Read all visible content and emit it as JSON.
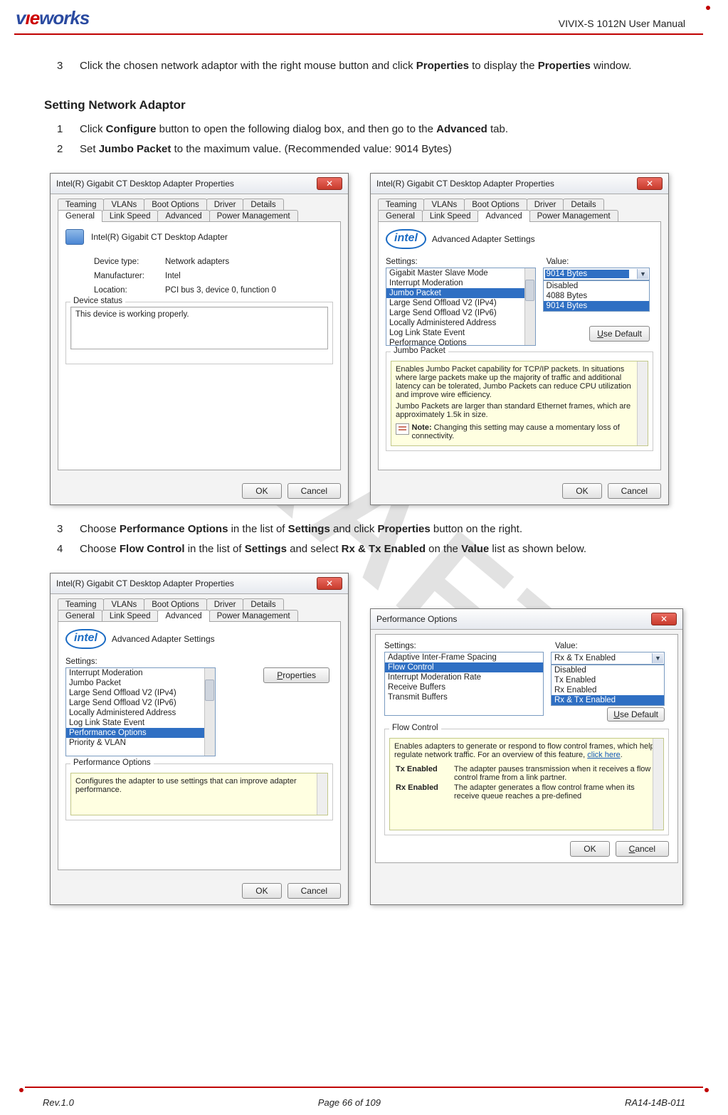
{
  "header": {
    "doc_title": "VIVIX-S 1012N User Manual",
    "logo_parts": {
      "a": "v",
      "b": "ı",
      "c": "e",
      "d": "works"
    }
  },
  "watermark": "DRAFT",
  "step_top": {
    "num": "3",
    "text_pre": "Click the chosen network adaptor with the right mouse button and click ",
    "bold1": "Properties",
    "text_mid": " to display the ",
    "bold2": "Properties",
    "text_post": " window."
  },
  "section1": {
    "heading": "Setting Network Adaptor",
    "s1": {
      "num": "1",
      "t1": "Click ",
      "b1": "Configure",
      "t2": " button to open the following dialog box, and then go to the ",
      "b2": "Advanced",
      "t3": " tab."
    },
    "s2": {
      "num": "2",
      "t1": "Set ",
      "b1": "Jumbo Packet",
      "t2": " to the maximum value. (Recommended value: 9014 Bytes)"
    }
  },
  "dialog_general": {
    "title": "Intel(R) Gigabit CT Desktop Adapter Properties",
    "tabs_row1": [
      "Teaming",
      "VLANs",
      "Boot Options",
      "Driver",
      "Details"
    ],
    "tabs_row2": [
      "General",
      "Link Speed",
      "Advanced",
      "Power Management"
    ],
    "active_tab": "General",
    "adapter_name": "Intel(R) Gigabit CT Desktop Adapter",
    "kv": [
      {
        "k": "Device type:",
        "v": "Network adapters"
      },
      {
        "k": "Manufacturer:",
        "v": "Intel"
      },
      {
        "k": "Location:",
        "v": "PCI bus 3, device 0, function 0"
      }
    ],
    "status_label": "Device status",
    "status_text": "This device is working properly.",
    "ok": "OK",
    "cancel": "Cancel"
  },
  "dialog_advanced_jumbo": {
    "title": "Intel(R) Gigabit CT Desktop Adapter Properties",
    "tabs_row1": [
      "Teaming",
      "VLANs",
      "Boot Options",
      "Driver",
      "Details"
    ],
    "tabs_row2": [
      "General",
      "Link Speed",
      "Advanced",
      "Power Management"
    ],
    "active_tab": "Advanced",
    "header_text": "Advanced Adapter Settings",
    "settings_label": "Settings:",
    "value_label": "Value:",
    "settings_list": [
      "Gigabit Master Slave Mode",
      "Interrupt Moderation",
      "Jumbo Packet",
      "Large Send Offload V2 (IPv4)",
      "Large Send Offload V2 (IPv6)",
      "Locally Administered Address",
      "Log Link State Event",
      "Performance Options"
    ],
    "selected_setting": "Jumbo Packet",
    "value_selected": "9014 Bytes",
    "value_options": [
      "Disabled",
      "4088 Bytes",
      "9014 Bytes"
    ],
    "use_default_label": "Use Default",
    "desc_title": "Jumbo Packet",
    "desc_p1": "Enables Jumbo Packet capability for TCP/IP packets. In situations where large packets make up the majority of traffic and additional latency can be tolerated, Jumbo Packets can reduce CPU utilization and improve wire efficiency.",
    "desc_p2": "Jumbo Packets are larger than standard Ethernet frames, which are approximately 1.5k in size.",
    "note_label": "Note:",
    "note_text": "Changing this setting may cause a momentary loss of connectivity.",
    "ok": "OK",
    "cancel": "Cancel"
  },
  "section2_steps": {
    "s3": {
      "num": "3",
      "t1": "Choose ",
      "b1": "Performance Options",
      "t2": " in the list of ",
      "b2": "Settings",
      "t3": " and click ",
      "b3": "Properties",
      "t4": " button on the right."
    },
    "s4": {
      "num": "4",
      "t1": "Choose ",
      "b1": "Flow Control",
      "t2": " in the list of ",
      "b2": "Settings",
      "t3": " and select ",
      "b3": "Rx & Tx Enabled",
      "t4": " on the ",
      "b4": "Value",
      "t5": " list as shown below."
    }
  },
  "dialog_advanced_perf": {
    "title": "Intel(R) Gigabit CT Desktop Adapter Properties",
    "tabs_row1": [
      "Teaming",
      "VLANs",
      "Boot Options",
      "Driver",
      "Details"
    ],
    "tabs_row2": [
      "General",
      "Link Speed",
      "Advanced",
      "Power Management"
    ],
    "active_tab": "Advanced",
    "header_text": "Advanced Adapter Settings",
    "settings_label": "Settings:",
    "settings_list": [
      "Interrupt Moderation",
      "Jumbo Packet",
      "Large Send Offload V2 (IPv4)",
      "Large Send Offload V2 (IPv6)",
      "Locally Administered Address",
      "Log Link State Event",
      "Performance Options",
      "Priority & VLAN"
    ],
    "selected_setting": "Performance Options",
    "properties_btn": "Properties",
    "desc_title": "Performance Options",
    "desc_text": "Configures the adapter to use settings that can improve adapter performance.",
    "ok": "OK",
    "cancel": "Cancel"
  },
  "dialog_perf_options": {
    "title": "Performance Options",
    "settings_label": "Settings:",
    "value_label": "Value:",
    "settings_list": [
      "Adaptive Inter-Frame Spacing",
      "Flow Control",
      "Interrupt Moderation Rate",
      "Receive Buffers",
      "Transmit Buffers"
    ],
    "selected_setting": "Flow Control",
    "value_selected": "Rx & Tx Enabled",
    "value_options": [
      "Disabled",
      "Tx Enabled",
      "Rx Enabled",
      "Rx & Tx Enabled"
    ],
    "use_default_label": "Use Default",
    "desc_title": "Flow Control",
    "desc_p1_a": "Enables adapters to generate or respond to flow control frames, which help regulate network traffic. For an overview of this feature, ",
    "desc_link": "click here",
    "desc_p1_b": ".",
    "tx_label": "Tx Enabled",
    "tx_text": "The adapter pauses transmission when it receives a flow control frame from a link partner.",
    "rx_label": "Rx Enabled",
    "rx_text": "The adapter generates a flow control frame when its receive queue reaches a pre-defined",
    "ok": "OK",
    "cancel": "Cancel"
  },
  "footer": {
    "rev": "Rev.1.0",
    "page": "Page 66 of 109",
    "code": "RA14-14B-011"
  }
}
